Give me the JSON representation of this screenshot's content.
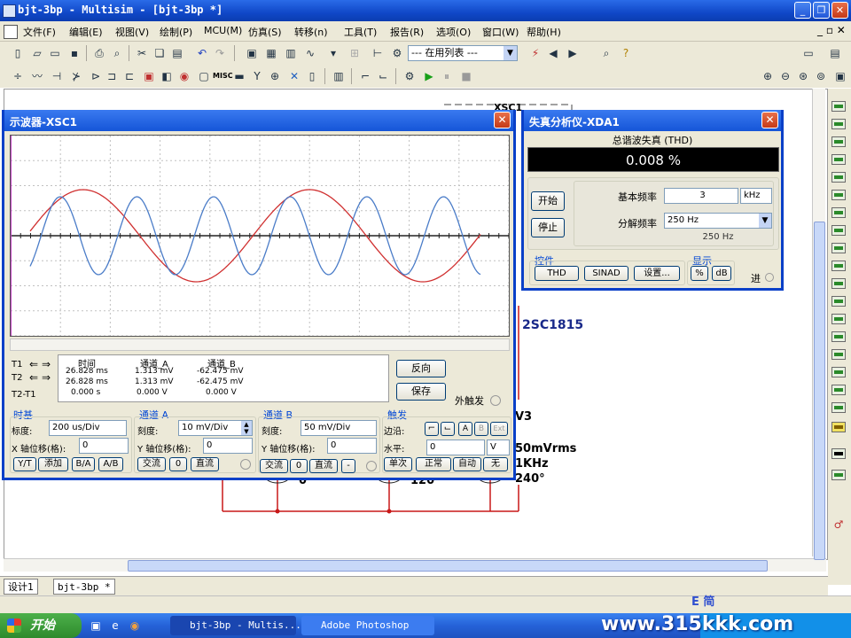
{
  "app": {
    "title": "bjt-3bp - Multisim - [bjt-3bp *]",
    "inner_controls": "_ ▫ ✕"
  },
  "menu": [
    {
      "label": "文件(F)"
    },
    {
      "label": "编辑(E)"
    },
    {
      "label": "视图(V)"
    },
    {
      "label": "绘制(P)"
    },
    {
      "label": "MCU(M)"
    },
    {
      "label": "仿真(S)"
    },
    {
      "label": "转移(n)"
    },
    {
      "label": "工具(T)"
    },
    {
      "label": "报告(R)"
    },
    {
      "label": "选项(O)"
    },
    {
      "label": "窗口(W)"
    },
    {
      "label": "帮助(H)"
    }
  ],
  "toolbar": {
    "in_use_list": "--- 在用列表 ---",
    "misc_label": "MISC"
  },
  "scope": {
    "title": "示波器-XSC1",
    "readout": {
      "col_time": "时间",
      "col_a": "通道_A",
      "col_b": "通道_B",
      "t1_label": "T1",
      "t2_label": "T2",
      "t21_label": "T2-T1",
      "t1": {
        "time": "26.828 ms",
        "a": "1.313 mV",
        "b": "-62.475 mV"
      },
      "t2": {
        "time": "26.828 ms",
        "a": "1.313 mV",
        "b": "-62.475 mV"
      },
      "t21": {
        "time": "0.000 s",
        "a": "0.000 V",
        "b": "0.000 V"
      }
    },
    "reverse_btn": "反向",
    "save_btn": "保存",
    "ext_trigger": "外触发",
    "timebase": {
      "title": "时基",
      "scale_label": "标度:",
      "scale": "200 us/Div",
      "xpos_label": "X 轴位移(格):",
      "xpos": "0",
      "buttons": [
        "Y/T",
        "添加",
        "B/A",
        "A/B"
      ]
    },
    "chA": {
      "title": "通道 A",
      "scale_label": "刻度:",
      "scale": "10 mV/Div",
      "ypos_label": "Y 轴位移(格):",
      "ypos": "0",
      "buttons": [
        "交流",
        "0",
        "直流"
      ]
    },
    "chB": {
      "title": "通道 B",
      "scale_label": "刻度:",
      "scale": "50 mV/Div",
      "ypos_label": "Y 轴位移(格):",
      "ypos": "0",
      "buttons": [
        "交流",
        "0",
        "直流",
        "-"
      ]
    },
    "trigger": {
      "title": "触发",
      "edge_label": "边沿:",
      "edge_buttons": [
        "A",
        "B",
        "Ext"
      ],
      "level_label": "水平:",
      "level": "0",
      "level_unit": "V",
      "mode_buttons": [
        "单次",
        "正常",
        "自动",
        "无"
      ]
    },
    "colors": {
      "chA": "#d03030",
      "chB": "#4a7cc8",
      "grid": "#c0c0c0"
    }
  },
  "waveform_data": {
    "chA_red": {
      "cycles_visible": 2.2
    },
    "chB_blue": {
      "cycles_visible": 6.5
    }
  },
  "distortion": {
    "title": "失真分析仪-XDA1",
    "header": "总谐波失真 (THD)",
    "value": "0.008 %",
    "start_btn": "开始",
    "stop_btn": "停止",
    "fund_label": "基本频率",
    "fund_value": "3",
    "fund_unit": "kHz",
    "res_label": "分解频率",
    "res_value": "250 Hz",
    "res_readout": "250 Hz",
    "controls_title": "控件",
    "controls": [
      "THD",
      "SINAD",
      "设置..."
    ],
    "display_title": "显示",
    "display": [
      "%",
      "dB"
    ],
    "in_label": "进"
  },
  "schematic": {
    "part": "2SC1815",
    "v3": "V3",
    "amp": "50mVrms",
    "freq": "1KHz",
    "phase": "240°",
    "p0": "0",
    "p120": "120",
    "xsc_label": "XSC1"
  },
  "tabs": [
    {
      "label": "设计1"
    },
    {
      "label": "bjt-3bp *"
    }
  ],
  "taskbar": {
    "start": "开始",
    "tasks": [
      {
        "label": "bjt-3bp - Multis..."
      },
      {
        "label": "Adobe Photoshop"
      }
    ],
    "watermark": "www.315kkk.com",
    "tray_prefix": "E 简"
  }
}
